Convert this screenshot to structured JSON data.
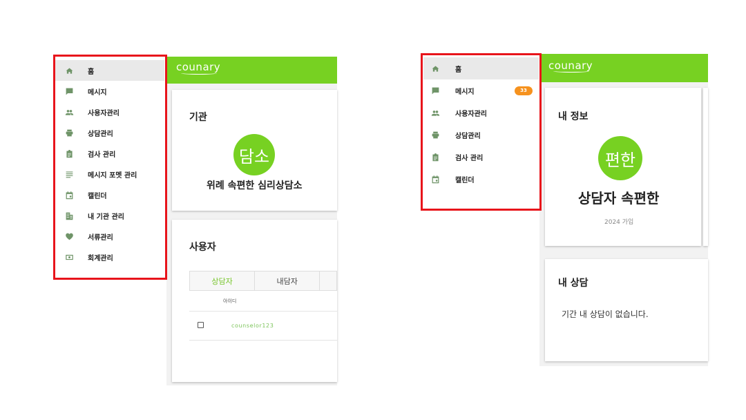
{
  "left_panel": {
    "logo": "counary",
    "sidebar": [
      {
        "label": "홈",
        "icon": "home-icon",
        "active": true
      },
      {
        "label": "메시지",
        "icon": "message-icon"
      },
      {
        "label": "사용자관리",
        "icon": "people-icon"
      },
      {
        "label": "상담관리",
        "icon": "printer-icon"
      },
      {
        "label": "검사 관리",
        "icon": "clipboard-icon"
      },
      {
        "label": "메시지 포멧 관리",
        "icon": "lines-icon"
      },
      {
        "label": "캘린더",
        "icon": "calendar-icon"
      },
      {
        "label": "내 기관 관리",
        "icon": "building-icon"
      },
      {
        "label": "서류관리",
        "icon": "heart-icon"
      },
      {
        "label": "회계관리",
        "icon": "money-icon"
      }
    ],
    "org_card": {
      "title": "기관",
      "avatar_text": "담소",
      "org_name": "위례 속편한 심리상담소"
    },
    "users_card": {
      "title": "사용자",
      "tabs": [
        {
          "label": "상담자",
          "active": true
        },
        {
          "label": "내담자"
        },
        {
          "label": ""
        }
      ],
      "column_header": "아이디",
      "rows": [
        {
          "id": "counselor123"
        }
      ]
    }
  },
  "right_panel": {
    "logo": "counary",
    "sidebar": [
      {
        "label": "홈",
        "icon": "home-icon",
        "active": true
      },
      {
        "label": "메시지",
        "icon": "message-icon",
        "badge": "33"
      },
      {
        "label": "사용자관리",
        "icon": "people-icon"
      },
      {
        "label": "상담관리",
        "icon": "printer-icon"
      },
      {
        "label": "검사 관리",
        "icon": "clipboard-icon"
      },
      {
        "label": "캘린더",
        "icon": "calendar-icon"
      }
    ],
    "info_card": {
      "title": "내 정보",
      "avatar_text": "편한",
      "name": "상담자 속편한",
      "joined": "2024 가입"
    },
    "sessions_card": {
      "title": "내 상담",
      "empty_message": "기간 내 상담이 없습니다."
    }
  },
  "colors": {
    "brand_green": "#77d122",
    "highlight_red": "#e8141b",
    "badge_orange": "#f6921e",
    "icon_green": "#6f9468"
  }
}
